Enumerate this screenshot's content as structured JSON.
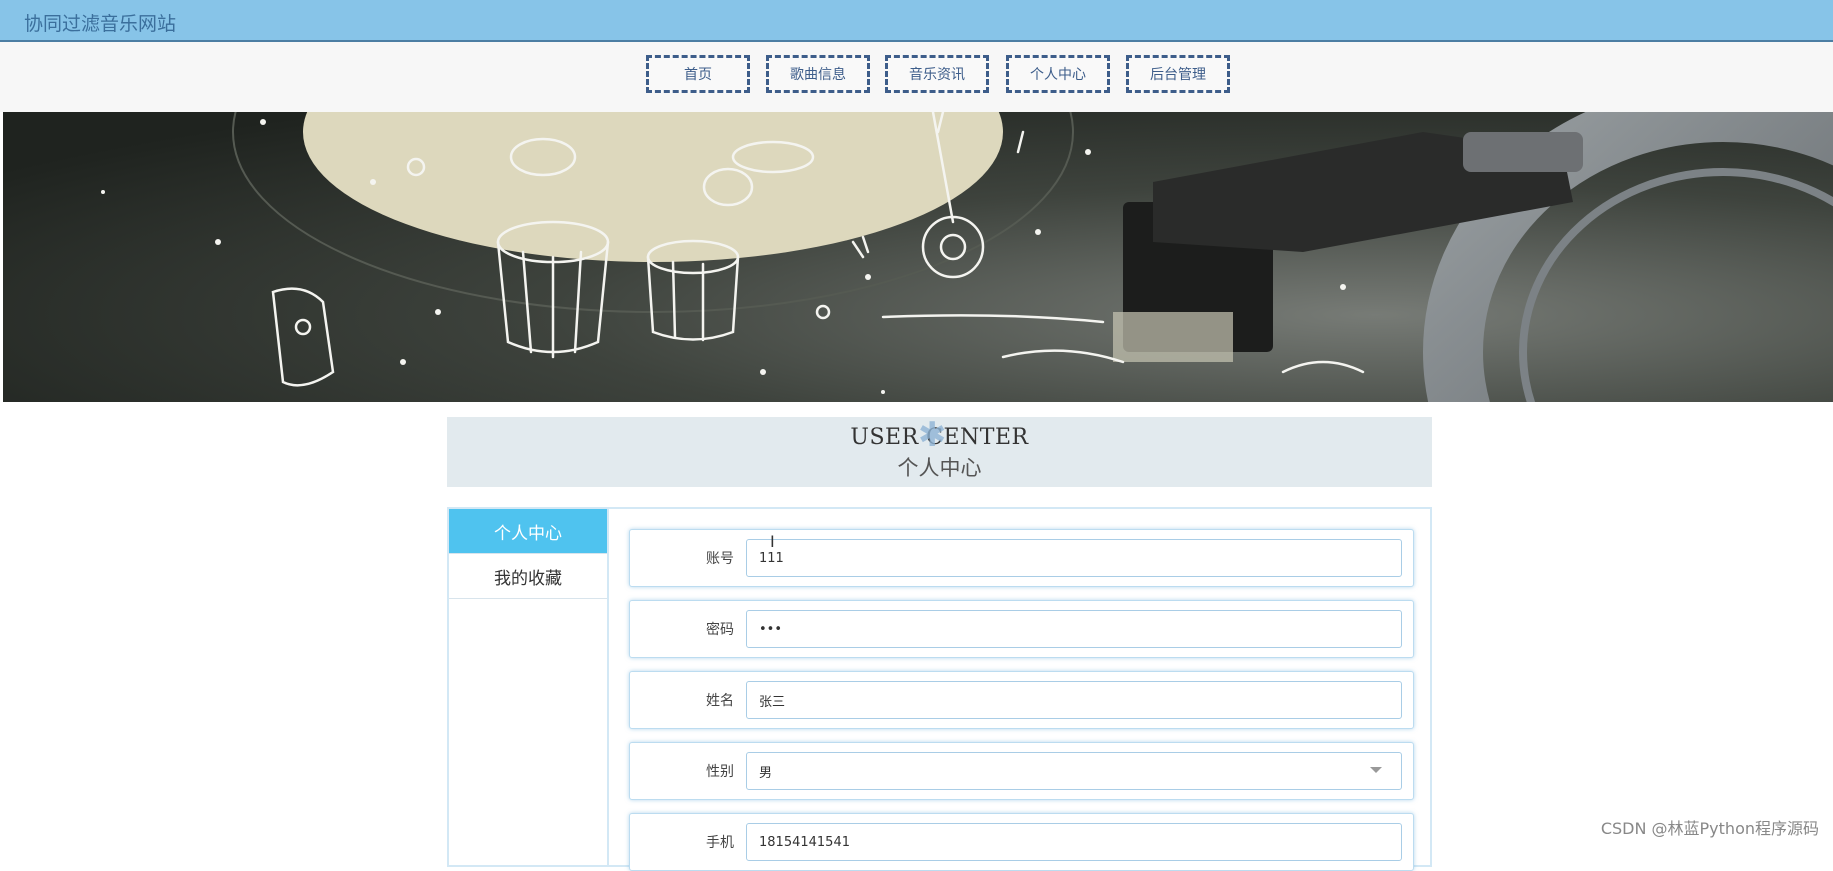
{
  "site": {
    "title": "协同过滤音乐网站"
  },
  "nav": {
    "items": [
      "首页",
      "歌曲信息",
      "音乐资讯",
      "个人中心",
      "后台管理"
    ]
  },
  "banner": {
    "active_slide": 1,
    "slide_count": 3
  },
  "section": {
    "title_en": "USER CENTER",
    "title_cn": "个人中心"
  },
  "sidebar": {
    "items": [
      {
        "label": "个人中心",
        "active": true
      },
      {
        "label": "我的收藏",
        "active": false
      }
    ]
  },
  "form": {
    "fields": [
      {
        "label": "账号",
        "value": "111"
      },
      {
        "label": "密码",
        "value": "•••"
      },
      {
        "label": "姓名",
        "value": "张三"
      },
      {
        "label": "性别",
        "value": "男"
      },
      {
        "label": "手机",
        "value": "18154141541"
      }
    ]
  },
  "watermark": "CSDN @林蓝Python程序源码",
  "colors": {
    "topbar": "#87c4e8",
    "accent": "#4fc3ef",
    "nav_border": "#3d5d8a"
  }
}
